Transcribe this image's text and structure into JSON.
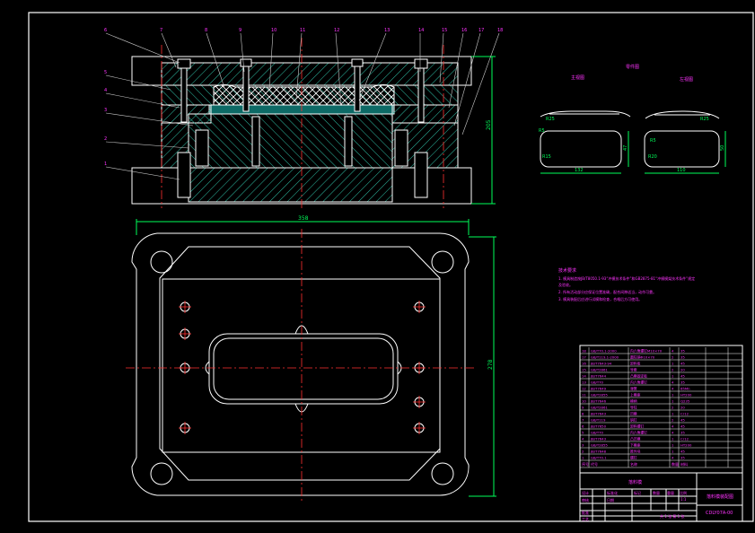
{
  "colors": {
    "background": "#000000",
    "frame": "#ffffff",
    "outline": "#ffffff",
    "hatch": "#2fbfa6",
    "center": "#ff3030",
    "dimension": "#00ff5a",
    "note": "#ff33ff",
    "leader": "#cccccc",
    "title": "#ff33ff"
  },
  "balloons": [
    "1",
    "2",
    "3",
    "4",
    "5",
    "6",
    "7",
    "8",
    "9",
    "10",
    "11",
    "12",
    "13",
    "14",
    "15",
    "16",
    "17",
    "18"
  ],
  "section_dims": {
    "height": "205"
  },
  "plan_dims": {
    "width": "358",
    "height": "278"
  },
  "part_view": {
    "title": "零件图",
    "left_label": "主视图",
    "right_label": "左视图",
    "left_width": "132",
    "left_height": "47",
    "left_radius_a": "R5",
    "left_radius_b": "R15",
    "left_radius_c": "R25",
    "right_width": "110",
    "right_height": "50",
    "right_radius_a": "R5",
    "right_radius_b": "R20",
    "right_radius_c": "R25"
  },
  "notes": {
    "heading": "技术要求",
    "line1": "1. 模具制造按JB/T8050.1-93“冲模技术条件”和GB2875-81“冲模模架技术条件”规定",
    "line1b": "   及验收。",
    "line2": "2. 所有活动部分应保证位置准确，配合间隙适当，动作可靠。",
    "line3": "3. 模具装配后应进行试模和检查，合格后方可使用。"
  },
  "bom": {
    "rows": [
      [
        "18",
        "GB/T70.1-2000",
        "内六角螺钉M10×70",
        "4",
        "35"
      ],
      [
        "17",
        "GB/T119.1-2000",
        "圆柱销Φ10×70",
        "2",
        "35"
      ],
      [
        "16",
        "JB/T7643-94",
        "卸料板",
        "1",
        "45"
      ],
      [
        "15",
        "GB/T2861",
        "导套",
        "2",
        "20"
      ],
      [
        "14",
        "JB/T7644",
        "凸模固定板",
        "1",
        "45"
      ],
      [
        "13",
        "GB/T70",
        "内六角螺钉",
        "4",
        "35"
      ],
      [
        "12",
        "JB/T7649",
        "弹簧",
        "4",
        "65Mn"
      ],
      [
        "11",
        "GB/T2855",
        "上模座",
        "1",
        "HT200"
      ],
      [
        "10",
        "JB/T7646",
        "模柄",
        "1",
        "Q235"
      ],
      [
        "9",
        "GB/T2861",
        "导柱",
        "2",
        "20"
      ],
      [
        "8",
        "JB/T7643",
        "凹模",
        "1",
        "Cr12"
      ],
      [
        "7",
        "GB/T119",
        "销钉",
        "2",
        "45"
      ],
      [
        "6",
        "JB/T7650",
        "卸料螺钉",
        "4",
        "45"
      ],
      [
        "5",
        "GB/T70",
        "内六角螺钉",
        "4",
        "35"
      ],
      [
        "4",
        "JB/T7643",
        "凸凹模",
        "1",
        "Cr12"
      ],
      [
        "3",
        "GB/T2855",
        "下模座",
        "1",
        "HT200"
      ],
      [
        "2",
        "JB/T7648",
        "推件块",
        "1",
        "45"
      ],
      [
        "1",
        "GB/T70.1",
        "螺钉",
        "4",
        "35"
      ]
    ],
    "header": [
      "序号",
      "代号",
      "名称",
      "数量",
      "材料"
    ],
    "drawing_title": "落料模",
    "drawing_name": "落料模装配图",
    "drawing_code": "CDLY07A-00",
    "scale": "1:1",
    "sheet": "共 1 张 第 1 张",
    "designer": "设计",
    "checker": "审核",
    "approver": "批准",
    "process": "工艺",
    "std": "标准化",
    "date": "日期",
    "mark": "标记",
    "qty": "数量",
    "weight": "重量",
    "ratio": "比例"
  }
}
